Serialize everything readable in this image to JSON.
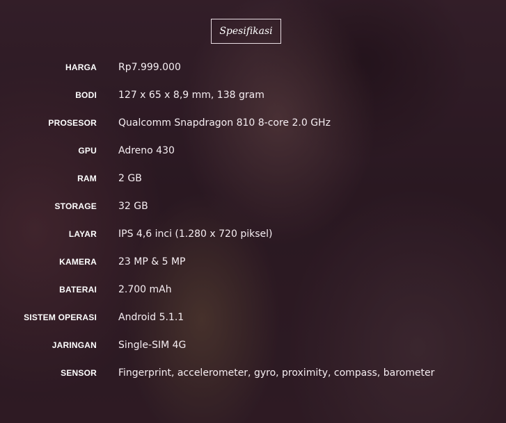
{
  "section": {
    "title": "Spesifikasi"
  },
  "specs": [
    {
      "label": "HARGA",
      "value": "Rp7.999.000"
    },
    {
      "label": "BODI",
      "value": "127 x 65 x 8,9 mm, 138 gram"
    },
    {
      "label": "PROSESOR",
      "value": "Qualcomm Snapdragon 810 8-core 2.0 GHz"
    },
    {
      "label": "GPU",
      "value": "Adreno 430"
    },
    {
      "label": "RAM",
      "value": "2 GB"
    },
    {
      "label": "STORAGE",
      "value": "32 GB"
    },
    {
      "label": "LAYAR",
      "value": "IPS 4,6 inci (1.280 x 720 piksel)"
    },
    {
      "label": "KAMERA",
      "value": "23 MP & 5 MP"
    },
    {
      "label": "BATERAI",
      "value": "2.700 mAh"
    },
    {
      "label": "SISTEM OPERASI",
      "value": "Android 5.1.1"
    },
    {
      "label": "JARINGAN",
      "value": "Single-SIM 4G"
    },
    {
      "label": "SENSOR",
      "value": "Fingerprint, accelerometer, gyro, proximity, compass, barometer"
    }
  ]
}
